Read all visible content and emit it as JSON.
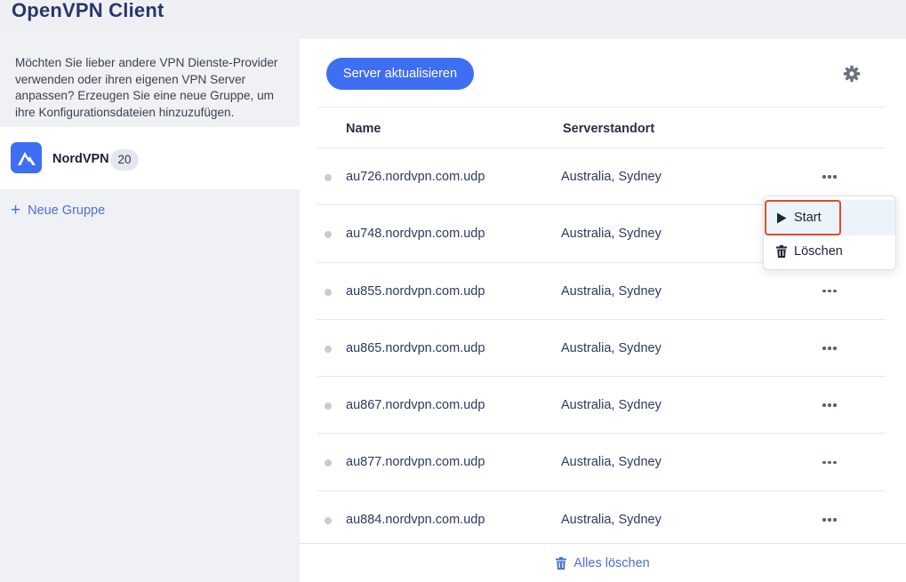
{
  "app": {
    "title": "OpenVPN Client"
  },
  "sidebar": {
    "hint": "Möchten Sie lieber andere VPN Dienste-Provider verwenden oder ihren eigenen VPN Server anpassen? Erzeugen Sie eine neue Gruppe, um ihre Konfigurationsdateien hinzuzufügen.",
    "group": {
      "name": "NordVPN",
      "count": "20",
      "icon": "nordvpn-logo"
    },
    "new_group": {
      "icon": "plus-icon",
      "label": "Neue Gruppe"
    }
  },
  "toolbar": {
    "refresh_label": "Server aktualisieren",
    "settings_icon": "gear-icon"
  },
  "table": {
    "columns": [
      "Name",
      "Serverstandort"
    ],
    "rows": [
      {
        "name": "au726.nordvpn.com.udp",
        "location": "Australia, Sydney"
      },
      {
        "name": "au748.nordvpn.com.udp",
        "location": "Australia, Sydney"
      },
      {
        "name": "au855.nordvpn.com.udp",
        "location": "Australia, Sydney"
      },
      {
        "name": "au865.nordvpn.com.udp",
        "location": "Australia, Sydney"
      },
      {
        "name": "au867.nordvpn.com.udp",
        "location": "Australia, Sydney"
      },
      {
        "name": "au877.nordvpn.com.udp",
        "location": "Australia, Sydney"
      },
      {
        "name": "au884.nordvpn.com.udp",
        "location": "Australia, Sydney"
      }
    ]
  },
  "context_menu": {
    "items": [
      {
        "label": "Start",
        "icon": "play-icon"
      },
      {
        "label": "Löschen",
        "icon": "trash-icon"
      }
    ]
  },
  "footer": {
    "delete_all_label": "Alles löschen",
    "icon": "trash-icon"
  },
  "colors": {
    "accent": "#3e6ef2",
    "link": "#4a6fd8",
    "highlight": "#e34a2a"
  }
}
